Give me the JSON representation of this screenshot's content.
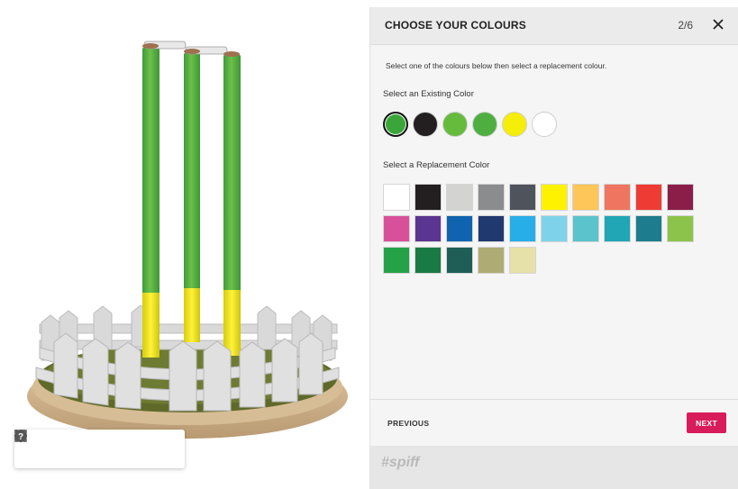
{
  "panel": {
    "title": "CHOOSE YOUR COLOURS",
    "step": "2/6",
    "close_icon": "close-icon",
    "instructions": "Select one of the colours below then select a replacement colour.",
    "existing_label": "Select an Existing Color",
    "replacement_label": "Select a Replacement Color",
    "existing_colors": [
      "#3aa63a",
      "#231f20",
      "#66bb3d",
      "#4fae40",
      "#f5ed0a",
      "#ffffff"
    ],
    "selected_existing": 0,
    "replacement_colors": [
      "#ffffff",
      "#231f20",
      "#d3d3d1",
      "#8a8c8e",
      "#4f535c",
      "#fff200",
      "#fec558",
      "#f07560",
      "#ee3b34",
      "#8b1e49",
      "#d9509a",
      "#5b3592",
      "#0f63af",
      "#20396f",
      "#27aee8",
      "#7ed3ea",
      "#5ac3cb",
      "#20a6b5",
      "#1d7c8e",
      "#8cc34b",
      "#25a248",
      "#1a7a43",
      "#1e5e57",
      "#aeac74",
      "#e6e1a9"
    ],
    "previous_label": "PREVIOUS",
    "next_label": "NEXT",
    "brand": "#spiff"
  },
  "toolbar": {
    "icons": [
      "pause-icon",
      "screenshot-icon",
      "rotate-icon",
      "fullscreen-icon",
      "help-icon"
    ]
  }
}
